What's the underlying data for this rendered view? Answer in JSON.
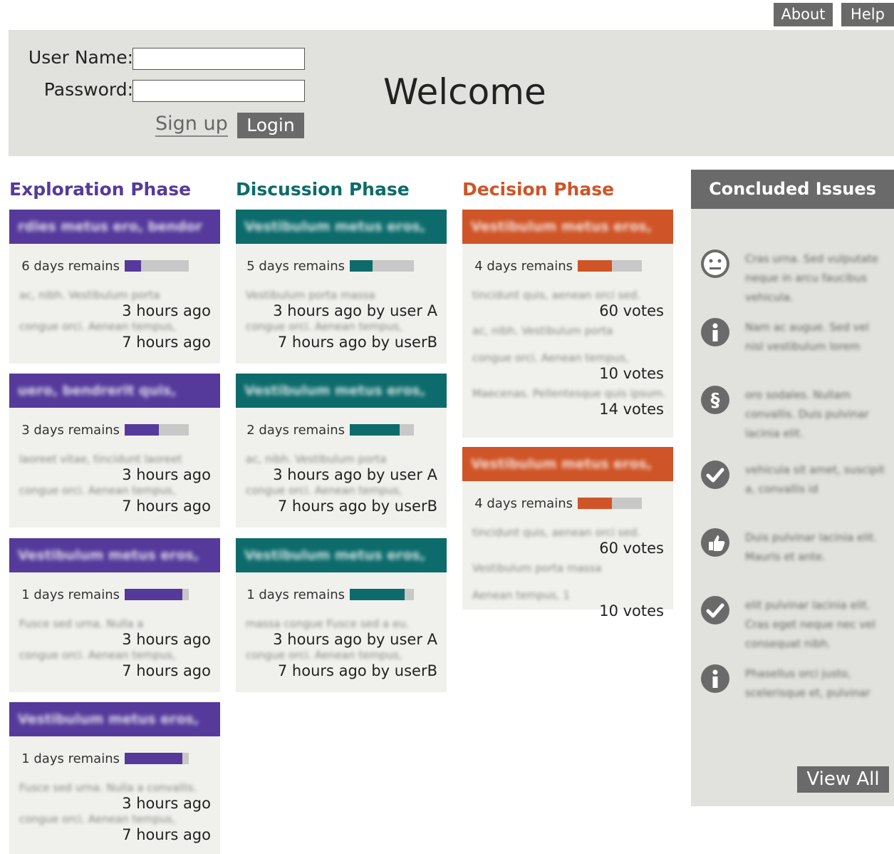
{
  "nav": {
    "about": "About",
    "help": "Help"
  },
  "login": {
    "username_label": "User Name:",
    "password_label": "Password:",
    "signup": "Sign up",
    "login": "Login",
    "welcome": "Welcome"
  },
  "phases": {
    "exploration": {
      "title": "Exploration Phase",
      "color": "#553a9b",
      "cards": [
        {
          "title": "rdies metus ero, bendor",
          "remain": "6 days remains",
          "progress": 0.25,
          "lines": [
            {
              "blur": "ac, nibh. Vestibulum porta",
              "meta": "3 hours ago"
            },
            {
              "blur": "congue orci. Aenean tempus,",
              "meta": "7 hours ago"
            }
          ]
        },
        {
          "title": "uero, bendrerit quis,",
          "remain": "3 days remains",
          "progress": 0.53,
          "lines": [
            {
              "blur": "laoreet vitae, tincidunt laoreet",
              "meta": "3 hours ago"
            },
            {
              "blur": "congue orci. Aenean tempus,",
              "meta": "7 hours ago"
            }
          ]
        },
        {
          "title": "Vestibulum metus eros,",
          "remain": "1 days remains",
          "progress": 0.9,
          "lines": [
            {
              "blur": "Fusce sed urna. Nulla a",
              "meta": "3 hours ago"
            },
            {
              "blur": "congue orci. Aenean tempus,",
              "meta": "7 hours ago"
            }
          ]
        },
        {
          "title": "Vestibulum metus eros,",
          "remain": "1 days remains",
          "progress": 0.9,
          "lines": [
            {
              "blur": "Fusce sed urna. Nulla a convallis.",
              "meta": "3 hours ago"
            },
            {
              "blur": "congue orci. Aenean tempus,",
              "meta": "7 hours ago"
            }
          ]
        }
      ]
    },
    "discussion": {
      "title": "Discussion Phase",
      "color": "#0d6b6b",
      "cards": [
        {
          "title": "Vestibulum metus eros,",
          "remain": "5 days remains",
          "progress": 0.36,
          "lines": [
            {
              "blur": "Vestibulum porta massa",
              "meta": "3 hours ago by user A"
            },
            {
              "blur": "congue orci. Aenean tempus,",
              "meta": "7 hours ago by userB"
            }
          ]
        },
        {
          "title": "Vestibulum metus eros,",
          "remain": "2 days remains",
          "progress": 0.78,
          "lines": [
            {
              "blur": "ac, nibh. Vestibulum porta",
              "meta": "3 hours ago by user A"
            },
            {
              "blur": "congue orci. Aenean tempus,",
              "meta": "7 hours ago by userB"
            }
          ]
        },
        {
          "title": "Vestibulum metus eros,",
          "remain": "1 days remains",
          "progress": 0.86,
          "lines": [
            {
              "blur": "massa congue Fusce sed a eu.",
              "meta": "3 hours ago by user A"
            },
            {
              "blur": "congue orci. Aenean tempus,",
              "meta": "7 hours ago by userB"
            }
          ]
        }
      ]
    },
    "decision": {
      "title": "Decision Phase",
      "color": "#cf5427",
      "cards": [
        {
          "title": "Vestibulum metus eros,",
          "remain": "4 days remains",
          "progress": 0.53,
          "lines": [
            {
              "blur": "tincidunt quis, aenean orci sed.",
              "meta": "60 votes"
            },
            {
              "blur": "ac, nibh. Vestibulum porta",
              "meta": ""
            },
            {
              "blur": "congue orci. Aenean tempus,",
              "meta": "10 votes"
            },
            {
              "blur": "Maecenas. Pellentesque quis ipsum.",
              "meta": "14 votes"
            }
          ]
        },
        {
          "title": "Vestibulum metus eros,",
          "remain": "4 days remains",
          "progress": 0.53,
          "lines": [
            {
              "blur": "tincidunt quis, aenean orci sed.",
              "meta": "60 votes"
            },
            {
              "blur": "Vestibulum porta massa",
              "meta": ""
            },
            {
              "blur": "Aenean tempus, 1",
              "meta": "10 votes"
            }
          ]
        }
      ]
    }
  },
  "concluded": {
    "title": "Concluded Issues",
    "view_all": "View All",
    "items": [
      {
        "icon": "neutral-face-icon",
        "text": "Cras urna. Sed vulputate neque in arcu faucibus vehicula."
      },
      {
        "icon": "info-icon",
        "text": "Nam ac augue. Sed vel nisl vestibulum lorem"
      },
      {
        "icon": "section-icon",
        "text": "oro sodales. Nullam convallis. Duis pulvinar lacinia elit."
      },
      {
        "icon": "check-icon",
        "text": "vehicula sit amet, suscipit a, convallis id"
      },
      {
        "icon": "thumbs-up-icon",
        "text": "Duis pulvinar lacinia elit. Mauris et ante."
      },
      {
        "icon": "check-icon",
        "text": "elit pulvinar lacinia elit. Cras eget neque nec vel consequat nibh."
      },
      {
        "icon": "info-icon",
        "text": "Phasellus orci justo, scelerisque et, pulvinar"
      }
    ]
  }
}
